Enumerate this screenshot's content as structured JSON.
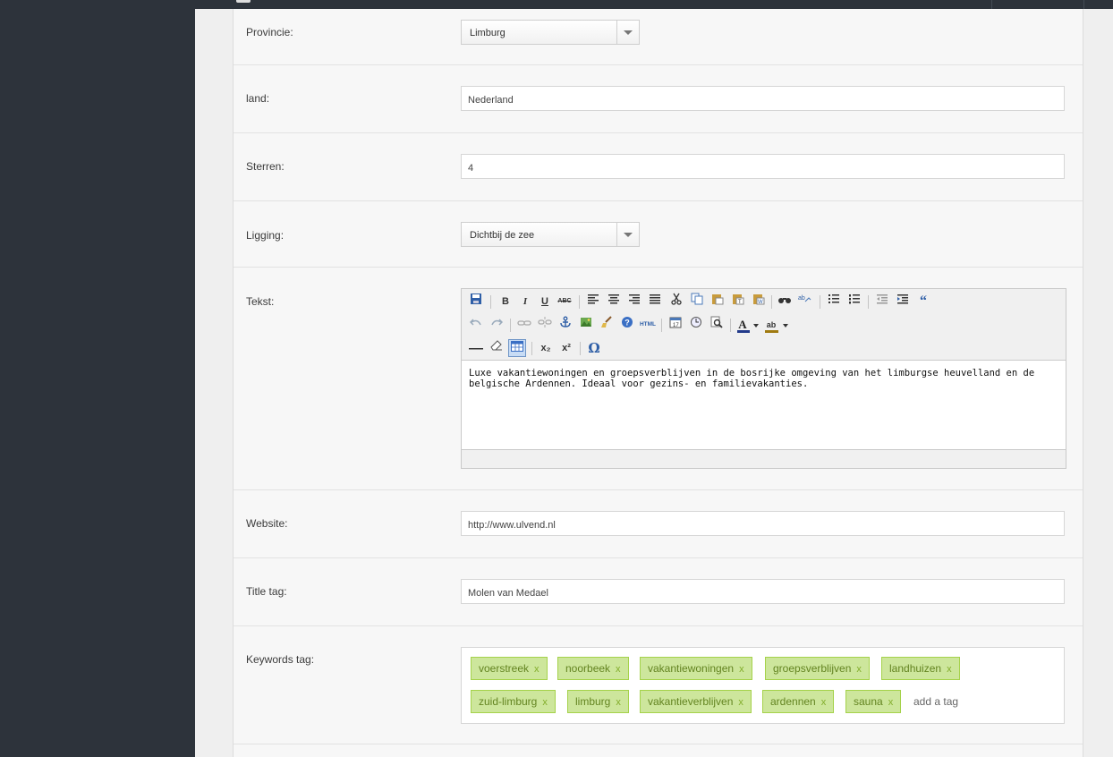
{
  "form": {
    "provincie": {
      "label": "Provincie:",
      "value": "Limburg"
    },
    "land": {
      "label": "land:",
      "value": "Nederland"
    },
    "sterren": {
      "label": "Sterren:",
      "value": "4"
    },
    "ligging": {
      "label": "Ligging:",
      "value": "Dichtbij de zee"
    },
    "tekst": {
      "label": "Tekst:",
      "content": "Luxe vakantiewoningen en groepsverblijven in de bosrijke omgeving van het limburgse heuvelland en de belgische Ardennen. Ideaal voor gezins- en familievakanties."
    },
    "website": {
      "label": "Website:",
      "value": "http://www.ulvend.nl"
    },
    "title_tag": {
      "label": "Title tag:",
      "value": "Molen van Medael"
    },
    "keywords_tag": {
      "label": "Keywords tag:",
      "tags": [
        "voerstreek",
        "noorbeek",
        "vakantiewoningen",
        "groepsverblijven",
        "landhuizen",
        "zuid-limburg",
        "limburg",
        "vakantieverblijven",
        "ardennen",
        "sauna"
      ],
      "remove": "x",
      "add_placeholder": "add a tag"
    }
  },
  "toolbar": {
    "bold": "B",
    "italic": "I",
    "underline": "U",
    "strikethrough": "ABC",
    "html": "HTML",
    "subscript": "x₂",
    "superscript": "x²",
    "omega": "Ω",
    "blockquote": "“",
    "font_color": "A",
    "highlight": "ab"
  },
  "colors": {
    "tag_bg": "#cde69c",
    "tag_border": "#a5d24a",
    "tag_text": "#638421",
    "sidebar": "#2d333b"
  }
}
